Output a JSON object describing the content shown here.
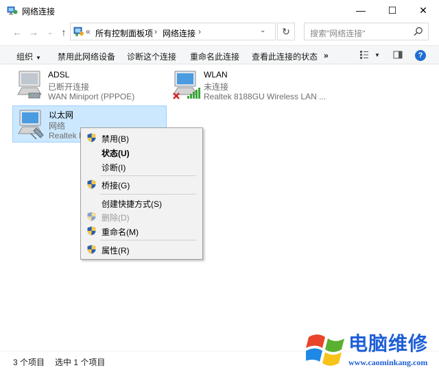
{
  "window": {
    "title": "网络连接",
    "minimize": "—",
    "maximize": "☐",
    "close": "✕"
  },
  "nav": {
    "back": "←",
    "forward": "→",
    "recent": "⌄",
    "up": "↑"
  },
  "address": {
    "overflow": "«",
    "crumbs": [
      "所有控制面板项",
      "网络连接"
    ],
    "separator": "›",
    "dropdown": "⌄",
    "refresh": "↻"
  },
  "search": {
    "placeholder": "搜索\"网络连接\""
  },
  "toolbar": {
    "organize": "组织",
    "disable": "禁用此网络设备",
    "diagnose": "诊断这个连接",
    "rename": "重命名此连接",
    "view_status": "查看此连接的状态",
    "more": "»",
    "help": "?"
  },
  "connections": [
    {
      "name": "ADSL",
      "status": "已断开连接",
      "device": "WAN Miniport (PPPOE)"
    },
    {
      "name": "WLAN",
      "status": "未连接",
      "device": "Realtek 8188GU Wireless LAN ..."
    },
    {
      "name": "以太网",
      "status": "网络",
      "device": "Realtek P"
    }
  ],
  "context_menu": {
    "items": [
      {
        "label": "禁用(B)",
        "shield": true
      },
      {
        "label": "状态(U)",
        "bold": true
      },
      {
        "label": "诊断(I)"
      },
      {
        "label": "桥接(G)",
        "shield": true
      },
      {
        "label": "创建快捷方式(S)"
      },
      {
        "label": "删除(D)",
        "shield": true,
        "disabled": true
      },
      {
        "label": "重命名(M)",
        "shield": true
      },
      {
        "label": "属性(R)",
        "shield": true
      }
    ]
  },
  "statusbar": {
    "count": "3 个项目",
    "selected": "选中 1 个项目"
  },
  "watermark": {
    "title": "电脑维修",
    "url": "www.caominkang.com"
  },
  "colors": {
    "selection": "#cce8ff",
    "accent": "#1f6fd1",
    "watermark": "#1e5fd6"
  }
}
